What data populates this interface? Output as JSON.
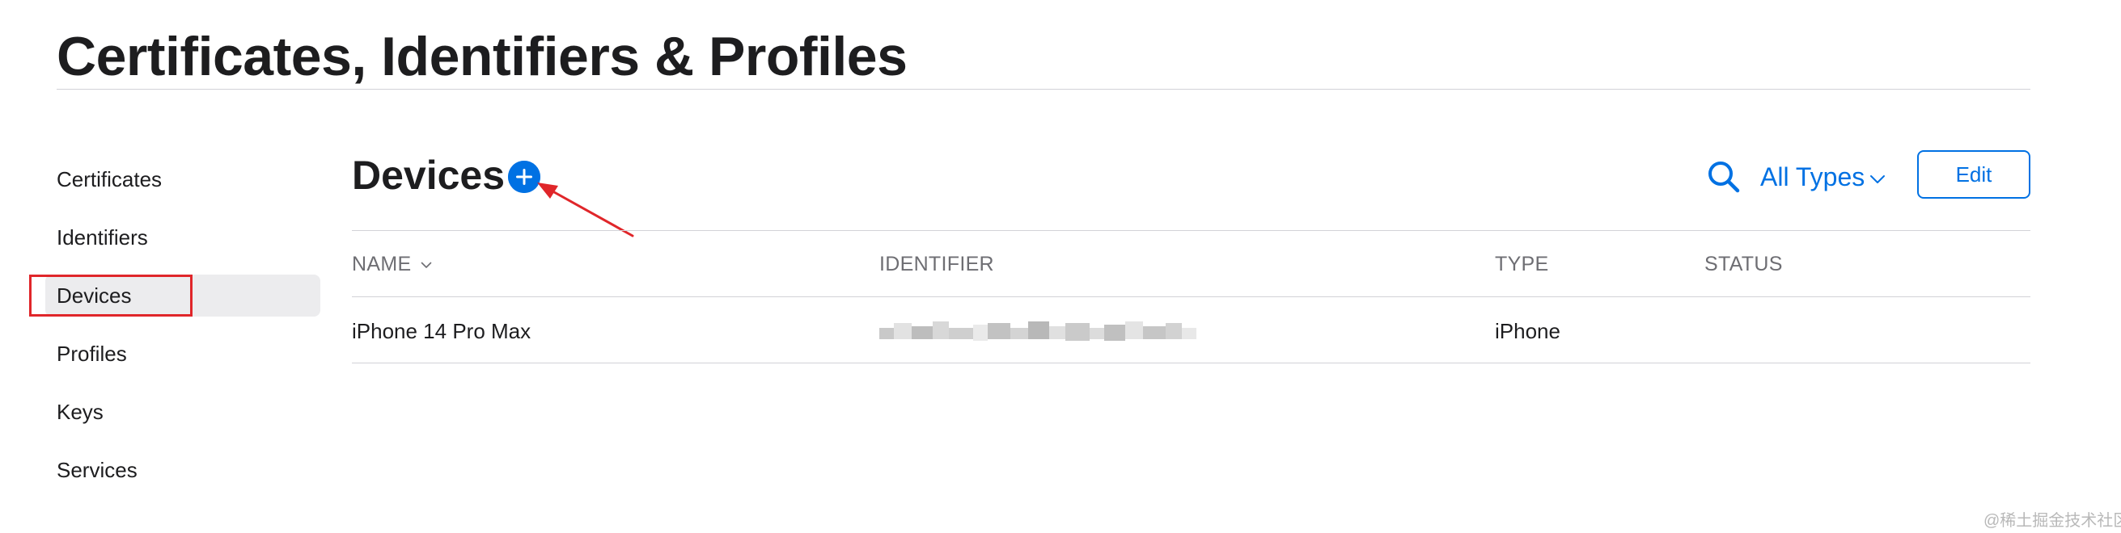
{
  "page": {
    "title": "Certificates, Identifiers & Profiles"
  },
  "sidebar": {
    "items": [
      {
        "label": "Certificates",
        "active": false
      },
      {
        "label": "Identifiers",
        "active": false
      },
      {
        "label": "Devices",
        "active": true
      },
      {
        "label": "Profiles",
        "active": false
      },
      {
        "label": "Keys",
        "active": false
      },
      {
        "label": "Services",
        "active": false
      }
    ]
  },
  "main": {
    "section_title": "Devices",
    "add_icon": "plus-circle-icon",
    "search_icon": "search-icon",
    "filter_label": "All Types",
    "filter_icon": "chevron-down-icon",
    "edit_label": "Edit"
  },
  "table": {
    "columns": [
      "NAME",
      "IDENTIFIER",
      "TYPE",
      "STATUS"
    ],
    "sort_icon": "chevron-down-icon",
    "rows": [
      {
        "name": "iPhone 14 Pro Max",
        "identifier_redacted": true,
        "type": "iPhone",
        "status": ""
      }
    ]
  },
  "annotations": {
    "highlight_color": "#e0262a",
    "arrow_color": "#e0262a"
  },
  "colors": {
    "accent": "#0071e3",
    "active_bg": "#ececee",
    "muted_text": "#6e6e73"
  },
  "watermark": "@稀土掘金技术社区"
}
